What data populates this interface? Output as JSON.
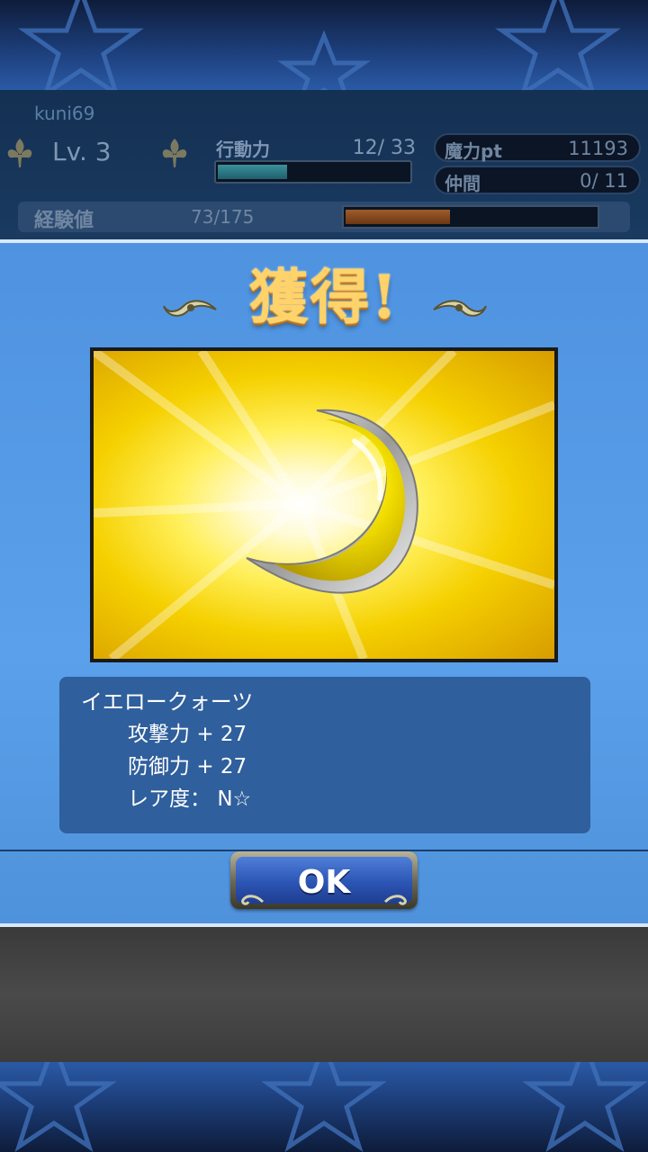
{
  "header": {
    "username": "kuni69",
    "level_label": "Lv. 3",
    "action_points": {
      "label": "行動力",
      "value_text": "12/ 33",
      "current": 12,
      "max": 33
    },
    "magic_pt": {
      "label": "魔力pt",
      "value": "11193"
    },
    "companions": {
      "label": "仲間",
      "value": "0/ 11"
    },
    "experience": {
      "label": "経験値",
      "value_text": "73/175",
      "current": 73,
      "max": 175
    }
  },
  "modal": {
    "title": "獲得!",
    "item": {
      "icon": "yellow-crescent-moon-gem",
      "name": "イエロークォーツ",
      "stats": [
        {
          "label": "攻撃力",
          "value": "+ 27"
        },
        {
          "label": "防御力",
          "value": "+ 27"
        },
        {
          "label": "レア度：",
          "value": "N☆"
        }
      ]
    },
    "ok_label": "OK"
  },
  "colors": {
    "modal_bg": "#5aa0ea",
    "title_gold": "#ffd36a",
    "ok_blue": "#2c55b4",
    "info_panel": "#2f5f9c"
  }
}
